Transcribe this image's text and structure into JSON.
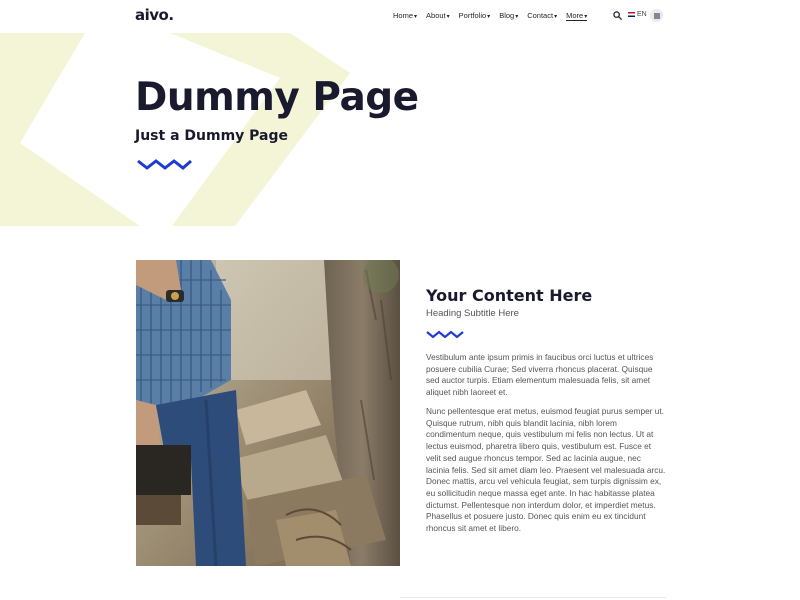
{
  "header": {
    "logo": "aivo.",
    "nav": [
      {
        "label": "Home"
      },
      {
        "label": "About"
      },
      {
        "label": "Portfolio"
      },
      {
        "label": "Blog"
      },
      {
        "label": "Contact"
      },
      {
        "label": "More",
        "active": true
      }
    ],
    "language": "EN",
    "icons": {
      "search": "search-icon",
      "flag": "uk-flag-icon",
      "menu": "hamburger-menu-icon"
    }
  },
  "hero": {
    "title": "Dummy Page",
    "subtitle": "Just a Dummy Page",
    "decoration": "zigzag-icon"
  },
  "content": {
    "image": "man-sitting-on-logs-photo",
    "title": "Your Content Here",
    "subtitle": "Heading Subtitle Here",
    "paragraphs": [
      "Vestibulum ante ipsum primis in faucibus orci luctus et ultrices posuere cubilia Curae; Sed viverra rhoncus placerat. Quisque sed auctor turpis. Etiam elementum malesuada felis, sit amet aliquet nibh laoreet et.",
      "Nunc pellentesque erat metus, euismod feugiat purus semper ut. Quisque rutrum, nibh quis blandit lacinia, nibh lorem condimentum neque, quis vestibulum mi felis non lectus. Ut at lectus euismod, pharetra libero quis, vestibulum est. Fusce et velit sed augue rhoncus tempor. Sed ac lacinia augue, nec lacinia felis. Sed sit amet diam leo. Praesent vel malesuada arcu. Donec mattis, arcu vel vehicula feugiat, sem turpis dignissim ex, eu sollicitudin neque massa eget ante. In hac habitasse platea dictumst. Pellentesque non interdum dolor, et imperdiet metus. Phasellus et posuere justo. Donec quis enim eu ex tincidunt rhoncus sit amet et libero."
    ]
  },
  "colors": {
    "accent": "#1e3bd6",
    "heading": "#1a1a2e",
    "background_shape": "#f4f5d6",
    "body_text": "#555555"
  }
}
